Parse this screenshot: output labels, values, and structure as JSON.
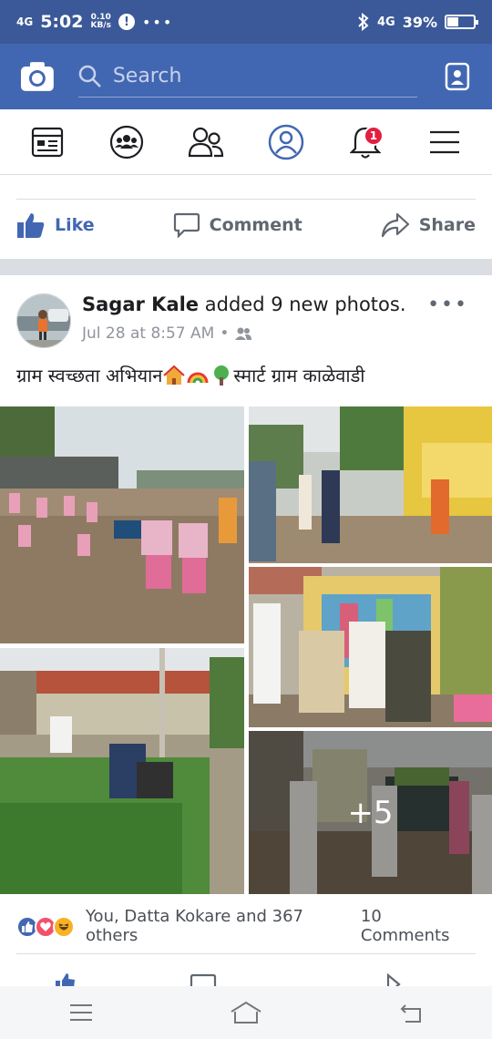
{
  "status_bar": {
    "network": "4G",
    "time": "5:02",
    "speed_value": "0.10",
    "speed_unit": "KB/s",
    "alert": "!",
    "overflow": "•••",
    "right_network": "4G",
    "battery": "39%",
    "battery_level": 0.39
  },
  "header": {
    "search_placeholder": "Search"
  },
  "nav": {
    "notification_count": "1"
  },
  "prev_post": {
    "like_label": "Like",
    "comment_label": "Comment",
    "share_label": "Share"
  },
  "post": {
    "author": "Sagar Kale",
    "action": "added 9 new photos.",
    "timestamp": "Jul 28 at 8:57 AM",
    "separator": "•",
    "text_part1": "ग्राम स्वच्छता अभियान ",
    "text_part2": "स्मार्ट ग्राम काळेवाडी",
    "more_photos": "+5",
    "reactions_text": "You, Datta Kokare and 367 others",
    "comments_text": "10 Comments",
    "more_options": "•••"
  },
  "colors": {
    "brand_blue": "#4267b2",
    "status_blue": "#3b5998",
    "like_blue": "#4267b2",
    "love_red": "#f25268",
    "haha_yellow": "#f7b125",
    "badge_red": "#e41e3f"
  },
  "icons": [
    "camera-icon",
    "search-icon",
    "messenger-icon",
    "news-feed-icon",
    "groups-icon",
    "friends-icon",
    "profile-icon",
    "bell-icon",
    "menu-icon",
    "like-icon",
    "comment-icon",
    "share-icon",
    "audience-friends-icon",
    "android-menu-icon",
    "android-home-icon",
    "android-back-icon"
  ]
}
